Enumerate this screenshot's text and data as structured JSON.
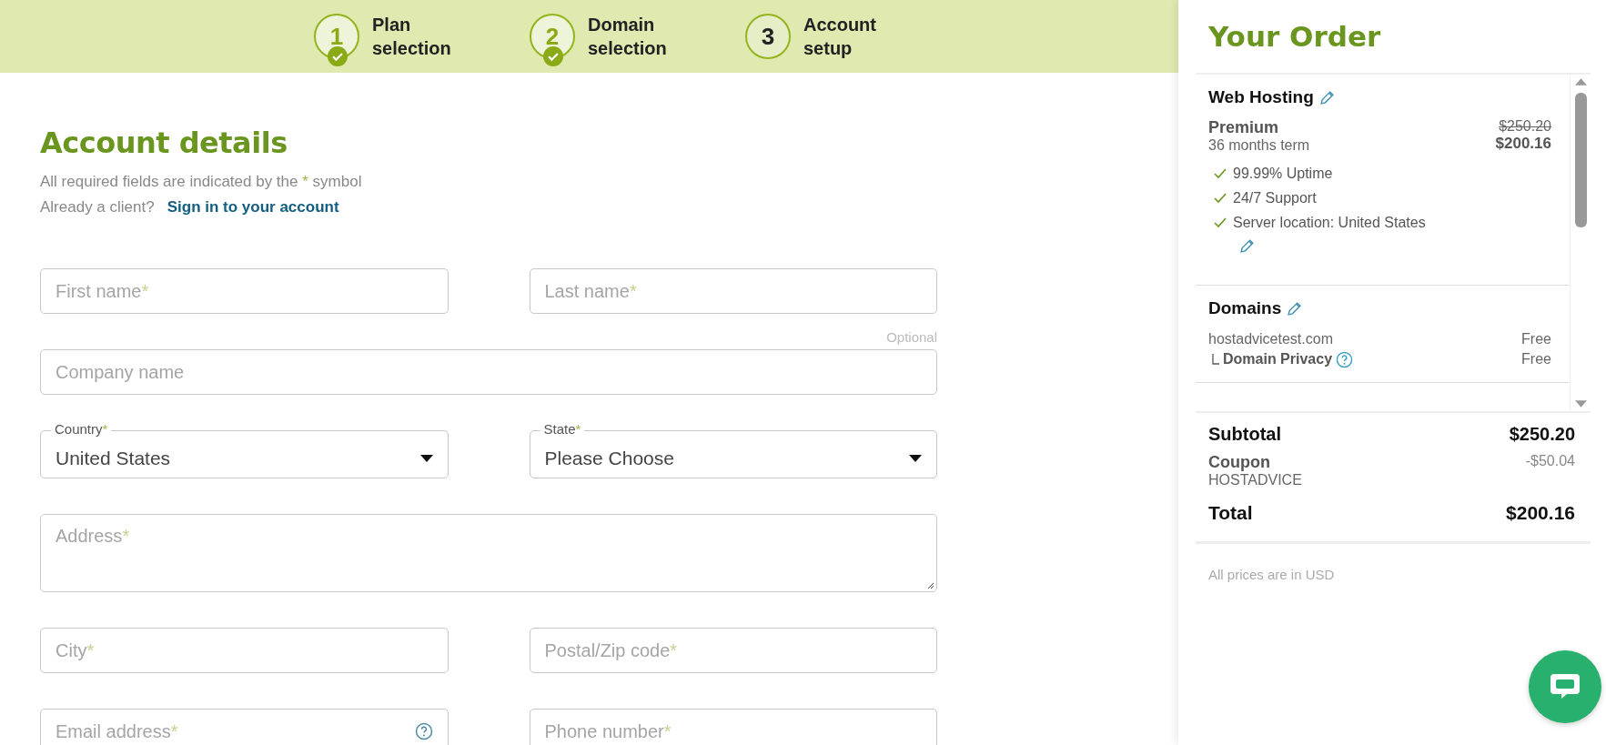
{
  "steps": [
    {
      "number": "1",
      "label": "Plan selection",
      "completed": true
    },
    {
      "number": "2",
      "label": "Domain selection",
      "completed": true
    },
    {
      "number": "3",
      "label": "Account setup",
      "completed": false
    }
  ],
  "form": {
    "title": "Account details",
    "required_note": {
      "before": "All required fields are indicated by the",
      "mark": "*",
      "after": "symbol"
    },
    "client_prompt": "Already a client?",
    "sign_in_link": "Sign in to your account",
    "rows": [
      [
        {
          "kind": "text",
          "label": "First name",
          "required_mark": "*"
        },
        {
          "kind": "text",
          "label": "Last name",
          "required_mark": "*"
        }
      ],
      [
        {
          "kind": "text",
          "label": "Company name",
          "note": "Optional",
          "wide": true
        }
      ],
      [
        {
          "kind": "select",
          "label": "Country",
          "required_mark": "*",
          "value": "United States"
        },
        {
          "kind": "select",
          "label": "State",
          "required_mark": "*",
          "value": "Please Choose"
        }
      ],
      [
        {
          "kind": "textarea",
          "label": "Address",
          "required_mark": "*",
          "wide": true
        }
      ],
      [
        {
          "kind": "text",
          "label": "City",
          "required_mark": "*"
        },
        {
          "kind": "text",
          "label": "Postal/Zip code",
          "required_mark": "*"
        }
      ],
      [
        {
          "kind": "text",
          "label": "Email address",
          "required_mark": "*",
          "help": true
        },
        {
          "kind": "text",
          "label": "Phone number",
          "required_mark": "*"
        }
      ]
    ]
  },
  "order": {
    "title": "Your Order",
    "hosting": {
      "heading": "Web Hosting",
      "plan": "Premium",
      "term": "36 months term",
      "old_price": "$250.20",
      "price": "$200.16",
      "features": [
        "99.99% Uptime",
        "24/7 Support",
        "Server location: United States"
      ]
    },
    "domains": {
      "heading": "Domains",
      "items": [
        {
          "name": "hostadvicetest.com",
          "price": "Free",
          "addon": false
        },
        {
          "name": "Domain Privacy",
          "price": "Free",
          "addon": true
        }
      ]
    },
    "subtotal": {
      "label": "Subtotal",
      "value": "$250.20"
    },
    "coupon": {
      "label": "Coupon",
      "code": "HOSTADVICE",
      "value": "-$50.04"
    },
    "total": {
      "label": "Total",
      "value": "$200.16"
    },
    "currency_note": "All prices are in USD"
  }
}
